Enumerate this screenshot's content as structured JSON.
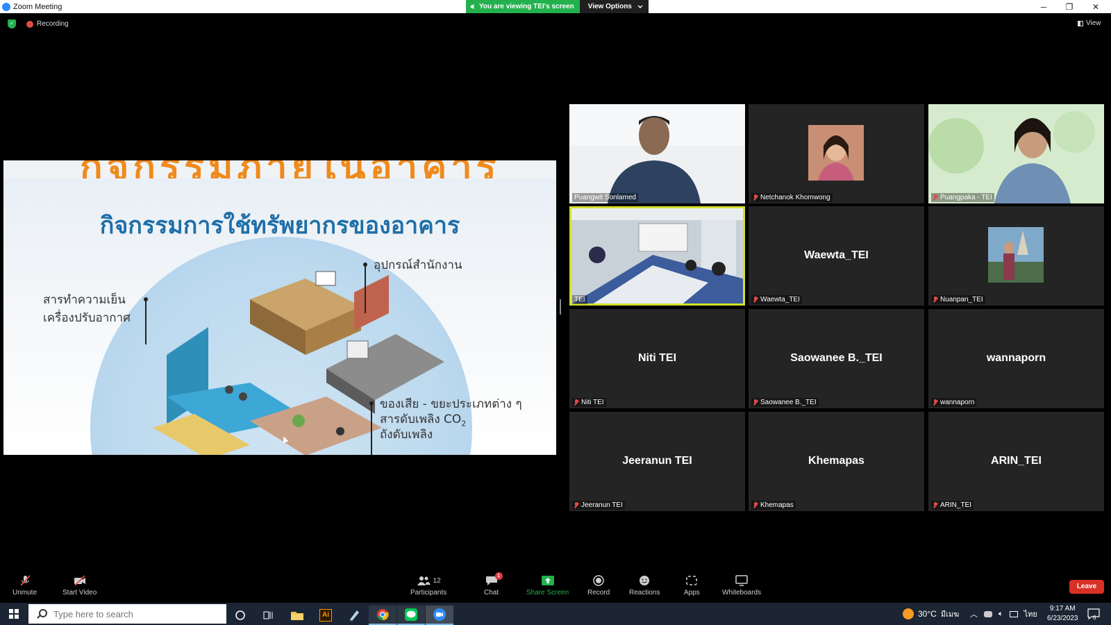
{
  "window": {
    "title": "Zoom Meeting",
    "viewing_banner": "You are viewing TEI's screen",
    "view_options_label": "View Options",
    "minimize_glyph": "─",
    "restore_glyph": "❐",
    "close_glyph": "✕"
  },
  "status": {
    "recording_label": "Recording",
    "view_label": "View"
  },
  "slide": {
    "top_banner_partial": "กิจกรรมภายในอาคาร",
    "title": "กิจกรรมการใช้ทรัพยากรของอาคาร",
    "label_office_equipment": "อุปกรณ์สำนักงาน",
    "label_refrigerant_line1": "สารทำความเย็น",
    "label_refrigerant_line2": "เครื่องปรับอากาศ",
    "label_waste_line1": "ของเสีย - ขยะประเภทต่าง ๆ",
    "label_waste_line2": "สารดับเพลิง CO",
    "label_waste_line2_sub": "2",
    "label_waste_line3": "ถังดับเพลิง"
  },
  "participants": [
    {
      "name": "Puangwit Sonlamed",
      "display": "",
      "muted": false,
      "video": "camera-man"
    },
    {
      "name": "Netchanok Khomwong",
      "display": "",
      "muted": true,
      "video": "avatar-photo"
    },
    {
      "name": "Puangpaka - TEI",
      "display": "",
      "muted": true,
      "video": "camera-woman"
    },
    {
      "name": "TEI",
      "display": "",
      "muted": false,
      "video": "meeting-room",
      "active_speaker": true
    },
    {
      "name": "Waewta_TEI",
      "display": "Waewta_TEI",
      "muted": true,
      "video": "none"
    },
    {
      "name": "Nuanpan_TEI",
      "display": "",
      "muted": true,
      "video": "avatar-photo"
    },
    {
      "name": "Niti TEI",
      "display": "Niti TEI",
      "muted": true,
      "video": "none"
    },
    {
      "name": "Saowanee B._TEI",
      "display": "Saowanee B._TEI",
      "muted": true,
      "video": "none"
    },
    {
      "name": "wannaporn",
      "display": "wannaporn",
      "muted": true,
      "video": "none"
    },
    {
      "name": "Jeeranun TEI",
      "display": "Jeeranun TEI",
      "muted": true,
      "video": "none"
    },
    {
      "name": "Khemapas",
      "display": "Khemapas",
      "muted": true,
      "video": "none"
    },
    {
      "name": "ARIN_TEI",
      "display": "ARIN_TEI",
      "muted": true,
      "video": "none"
    }
  ],
  "toolbar": {
    "unmute": "Unmute",
    "start_video": "Start Video",
    "participants": "Participants",
    "participants_count": "12",
    "chat": "Chat",
    "chat_badge": "1",
    "share_screen": "Share Screen",
    "record": "Record",
    "reactions": "Reactions",
    "apps": "Apps",
    "whiteboards": "Whiteboards",
    "leave": "Leave",
    "caret": "⌃"
  },
  "taskbar": {
    "search_placeholder": "Type here to search",
    "weather": "30°C",
    "weather_desc": "มีเมฆ",
    "lang": "ไทย",
    "time": "9:17 AM",
    "date": "6/23/2023",
    "notification_count": "6",
    "ai_label": "Ai"
  },
  "colors": {
    "accent_green": "#23b14d",
    "active_speaker": "#d4e02c",
    "leave_red": "#d93025",
    "zoom_blue": "#2d8cff"
  }
}
